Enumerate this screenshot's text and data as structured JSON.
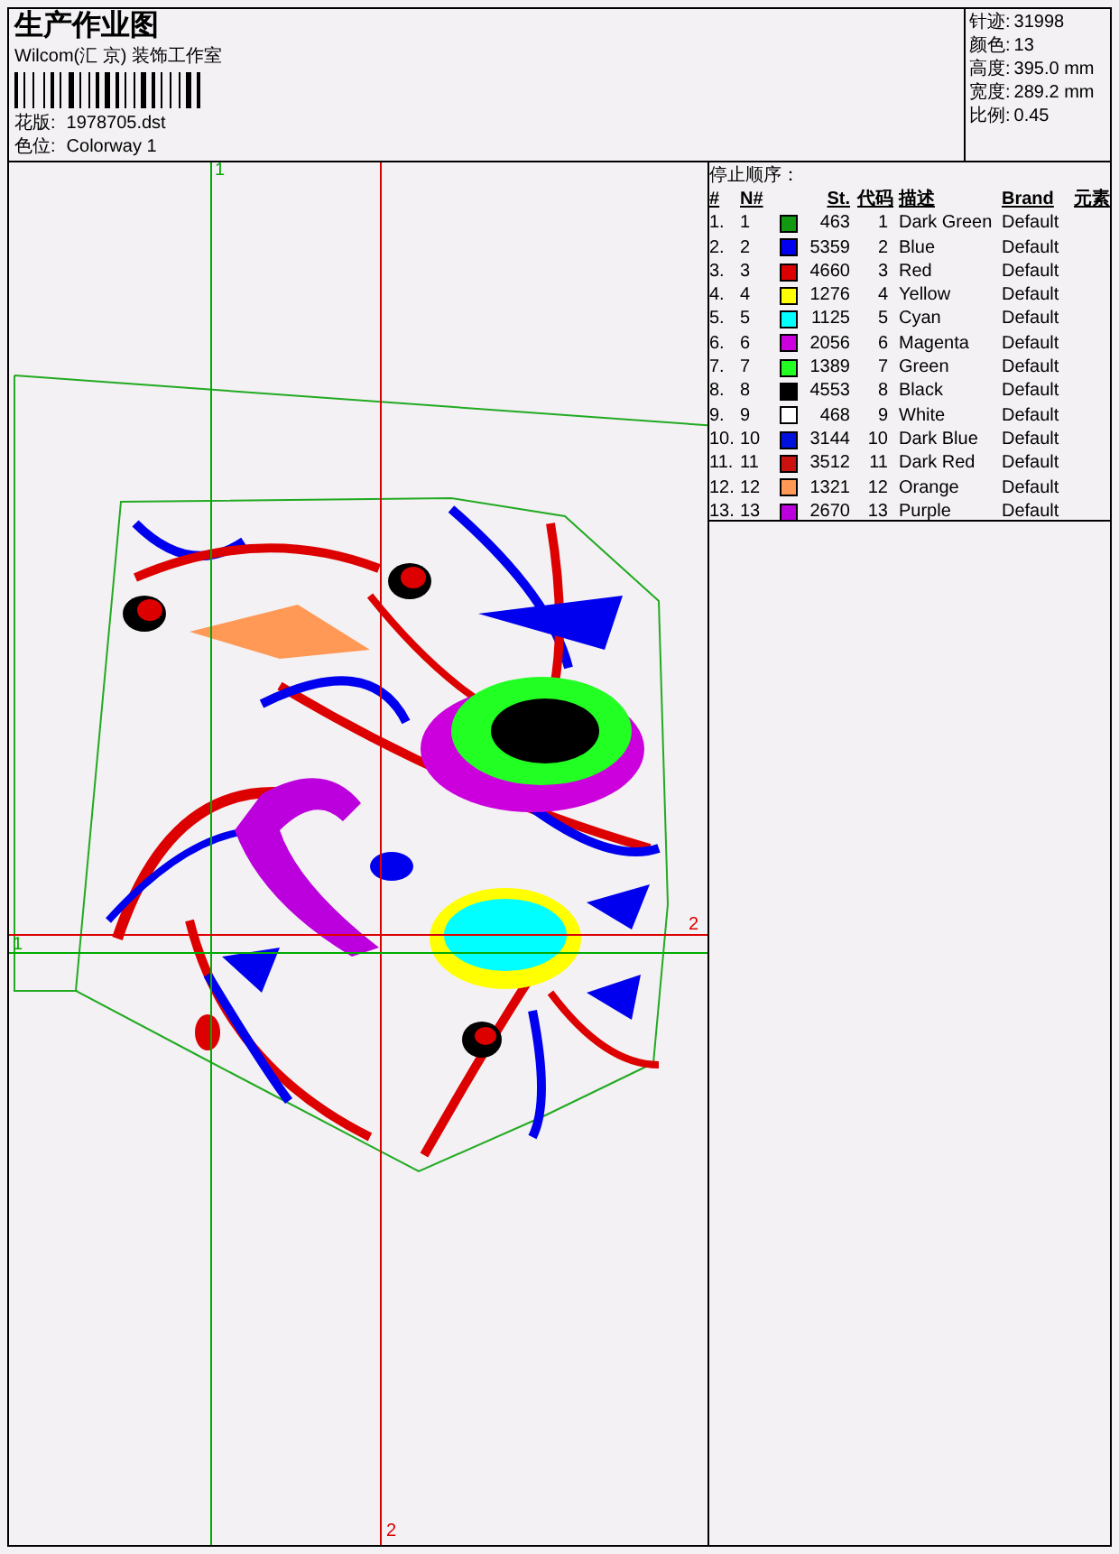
{
  "header": {
    "title": "生产作业图",
    "company": "Wilcom(汇 京) 装饰工作室",
    "fields": [
      {
        "label": "花版:",
        "value": "1978705.dst"
      },
      {
        "label": "色位:",
        "value": "Colorway 1"
      }
    ]
  },
  "info": [
    {
      "label": "针迹:",
      "value": "31998"
    },
    {
      "label": "颜色:",
      "value": "13"
    },
    {
      "label": "高度:",
      "value": "395.0 mm"
    },
    {
      "label": "宽度:",
      "value": "289.2 mm"
    },
    {
      "label": "比例:",
      "value": "0.45"
    }
  ],
  "guides": [
    {
      "label": "1",
      "kind": "vertical",
      "color": "#00aa00"
    },
    {
      "label": "2",
      "kind": "vertical",
      "color": "#dd0000"
    },
    {
      "label": "2",
      "kind": "horizontal",
      "color": "#dd0000"
    },
    {
      "label": "1",
      "kind": "horizontal",
      "color": "#00aa00"
    }
  ],
  "stop_sequence": {
    "title": "停止顺序：",
    "columns": [
      "#",
      "N#",
      "St.",
      "代码",
      "描述",
      "Brand",
      "元素"
    ],
    "rows": [
      {
        "index": "1.",
        "needle": "1",
        "color": "#119911",
        "stitches": "463",
        "code": "1",
        "description": "Dark Green",
        "brand": "Default"
      },
      {
        "index": "2.",
        "needle": "2",
        "color": "#0000ee",
        "stitches": "5359",
        "code": "2",
        "description": "Blue",
        "brand": "Default"
      },
      {
        "index": "3.",
        "needle": "3",
        "color": "#dd0000",
        "stitches": "4660",
        "code": "3",
        "description": "Red",
        "brand": "Default"
      },
      {
        "index": "4.",
        "needle": "4",
        "color": "#ffff00",
        "stitches": "1276",
        "code": "4",
        "description": "Yellow",
        "brand": "Default"
      },
      {
        "index": "5.",
        "needle": "5",
        "color": "#00ffff",
        "stitches": "1125",
        "code": "5",
        "description": "Cyan",
        "brand": "Default"
      },
      {
        "index": "6.",
        "needle": "6",
        "color": "#cc00dd",
        "stitches": "2056",
        "code": "6",
        "description": "Magenta",
        "brand": "Default"
      },
      {
        "index": "7.",
        "needle": "7",
        "color": "#22ff22",
        "stitches": "1389",
        "code": "7",
        "description": "Green",
        "brand": "Default"
      },
      {
        "index": "8.",
        "needle": "8",
        "color": "#000000",
        "stitches": "4553",
        "code": "8",
        "description": "Black",
        "brand": "Default"
      },
      {
        "index": "9.",
        "needle": "9",
        "color": "#ffffff",
        "stitches": "468",
        "code": "9",
        "description": "White",
        "brand": "Default"
      },
      {
        "index": "10.",
        "needle": "10",
        "color": "#0011dd",
        "stitches": "3144",
        "code": "10",
        "description": "Dark Blue",
        "brand": "Default"
      },
      {
        "index": "11.",
        "needle": "11",
        "color": "#cc1111",
        "stitches": "3512",
        "code": "11",
        "description": "Dark Red",
        "brand": "Default"
      },
      {
        "index": "12.",
        "needle": "12",
        "color": "#ff9955",
        "stitches": "1321",
        "code": "12",
        "description": "Orange",
        "brand": "Default"
      },
      {
        "index": "13.",
        "needle": "13",
        "color": "#bb00dd",
        "stitches": "2670",
        "code": "13",
        "description": "Purple",
        "brand": "Default"
      }
    ]
  }
}
